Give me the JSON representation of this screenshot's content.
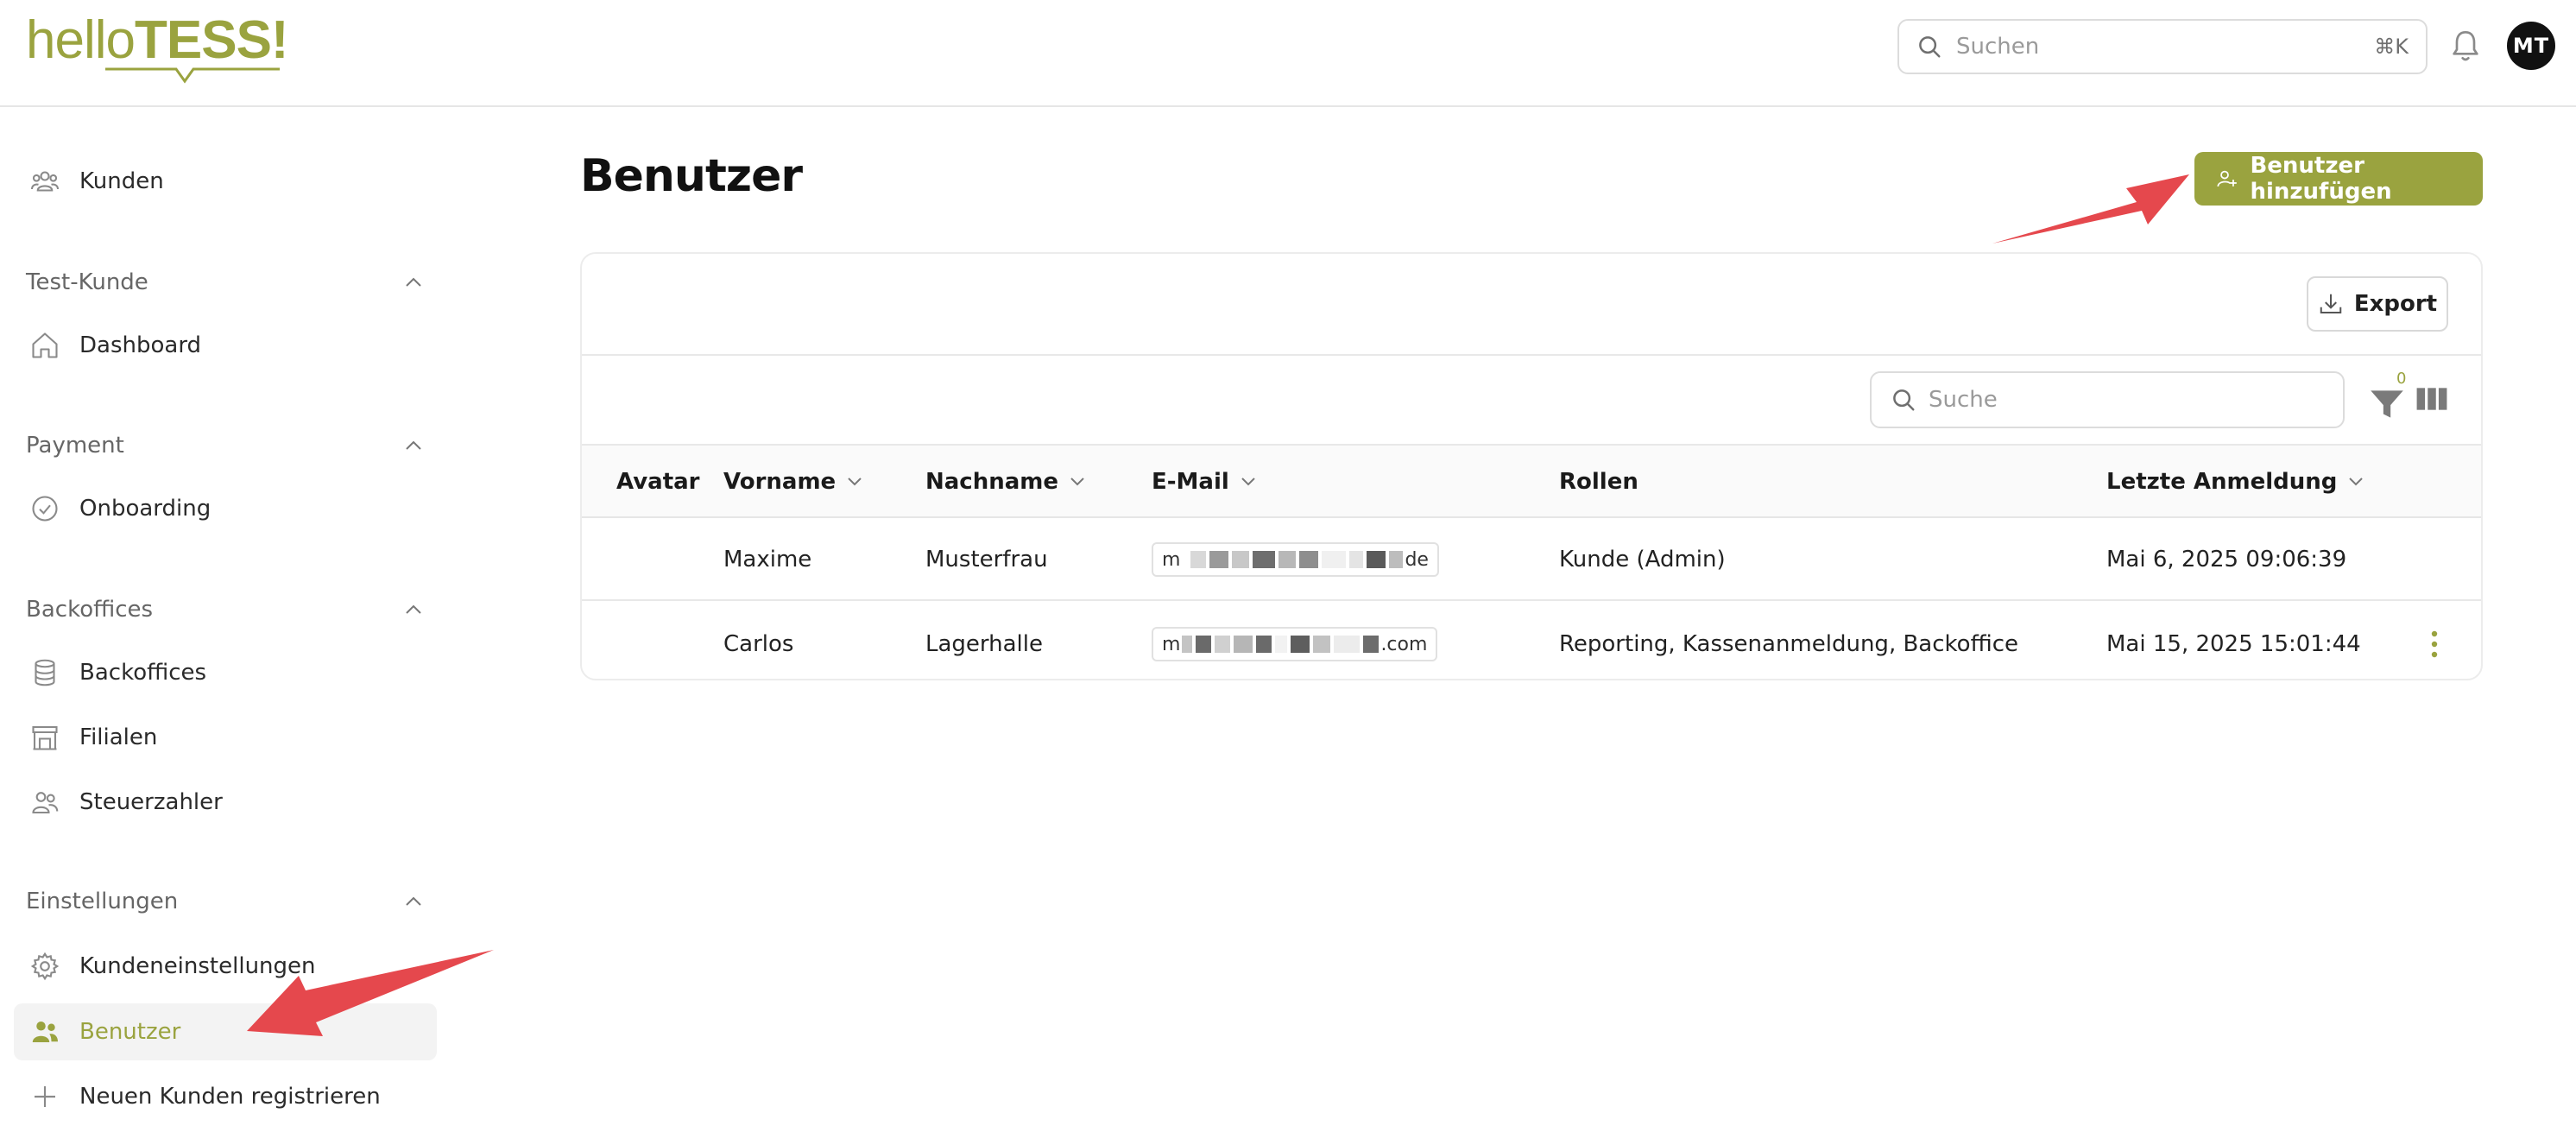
{
  "header": {
    "logo_hello": "hello",
    "logo_tess": "TESS!",
    "search_placeholder": "Suchen",
    "search_shortcut": "⌘K",
    "avatar_initials": "MT"
  },
  "sidebar": {
    "top_item": {
      "label": "Kunden",
      "icon": "users-icon"
    },
    "sections": [
      {
        "title": "Test-Kunde",
        "items": [
          {
            "label": "Dashboard",
            "icon": "home-icon"
          }
        ]
      },
      {
        "title": "Payment",
        "items": [
          {
            "label": "Onboarding",
            "icon": "check-circle-icon"
          }
        ]
      },
      {
        "title": "Backoffices",
        "items": [
          {
            "label": "Backoffices",
            "icon": "database-icon"
          },
          {
            "label": "Filialen",
            "icon": "store-icon"
          },
          {
            "label": "Steuerzahler",
            "icon": "users-icon"
          }
        ]
      },
      {
        "title": "Einstellungen",
        "items": [
          {
            "label": "Kundeneinstellungen",
            "icon": "gear-icon"
          },
          {
            "label": "Benutzer",
            "icon": "users-filled-icon",
            "active": true
          },
          {
            "label": "Neuen Kunden registrieren",
            "icon": "plus-icon"
          }
        ]
      }
    ]
  },
  "main": {
    "title": "Benutzer",
    "add_button": "Benutzer hinzufügen",
    "export_button": "Export",
    "table_search_placeholder": "Suche",
    "filter_count": "0",
    "columns": [
      "Avatar",
      "Vorname",
      "Nachname",
      "E-Mail",
      "Rollen",
      "Letzte Anmeldung"
    ],
    "rows": [
      {
        "vorname": "Maxime",
        "nachname": "Musterfrau",
        "email_prefix": "m",
        "email_suffix": "de",
        "rollen": "Kunde (Admin)",
        "letzte_anmeldung": "Mai 6, 2025 09:06:39"
      },
      {
        "vorname": "Carlos",
        "nachname": "Lagerhalle",
        "email_prefix": "m",
        "email_suffix": ".com",
        "rollen": "Reporting, Kassenanmeldung, Backoffice",
        "letzte_anmeldung": "Mai 15, 2025 15:01:44"
      }
    ]
  },
  "colors": {
    "accent": "#9aa33f",
    "annotation_arrow": "#e5484d"
  }
}
